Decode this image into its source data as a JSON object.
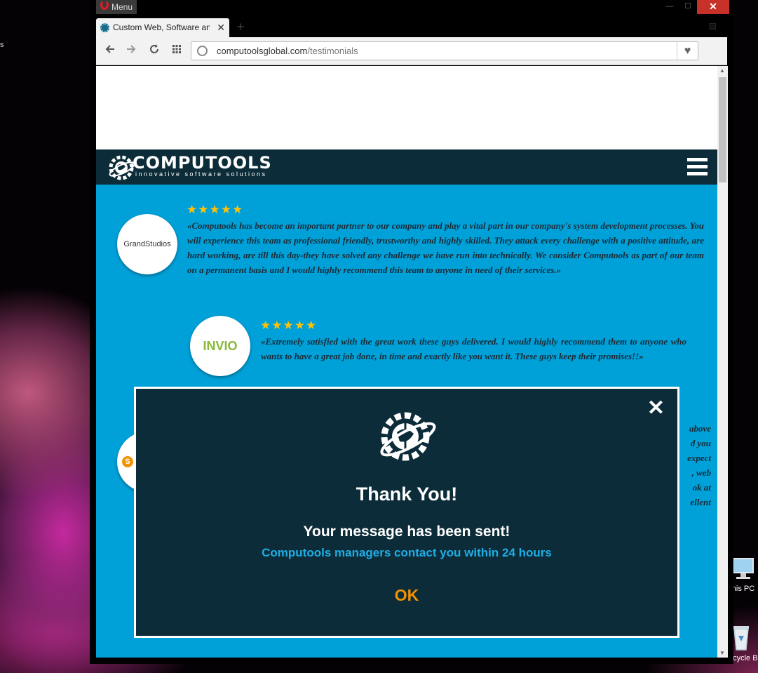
{
  "browser": {
    "menu_label": "Menu",
    "tab_title": "Custom Web, Software and",
    "tab_close": "✕",
    "new_tab": "+",
    "url_host": "computoolsglobal.com",
    "url_path": "/testimonials",
    "window_min": "—",
    "window_max": "☐",
    "window_close": "✕"
  },
  "desktop": {
    "left_text": "s",
    "this_pc_label": "his PC",
    "recycle_label": "Recycle Bi"
  },
  "site": {
    "logo_name": "COMPUTOOLS",
    "logo_tagline": "innovative software solutions"
  },
  "testimonials": [
    {
      "company": "GrandStudios",
      "stars": "★★★★★",
      "quote": "«Computools has become an important partner to our company and play a vital part in our company's system development processes. You will experience this team as professional friendly, trustworthy and highly skilled. They attack every challenge with a positive attitude, are hard working, are till this day-they have solved any challenge we have run into technically. We consider Computools as part of our team on a permanent basis and I would highly recommend this team to anyone in need of their services.»"
    },
    {
      "company": "INVIO",
      "stars": "★★★★★",
      "quote": "«Extremely satisfied with the great work these guys delivered. I would highly recommend them to anyone who wants to have a great job done, in time and exactly like you want it. These guys keep their promises!!»"
    },
    {
      "company": "S",
      "fragments": [
        "above",
        "d you",
        "expect",
        ", web",
        "ok at",
        "ellent"
      ]
    }
  ],
  "modal": {
    "close": "✕",
    "title": "Thank You!",
    "subtitle": "Your message has been sent!",
    "note": "Computools managers contact you within 24 hours",
    "ok": "OK"
  }
}
